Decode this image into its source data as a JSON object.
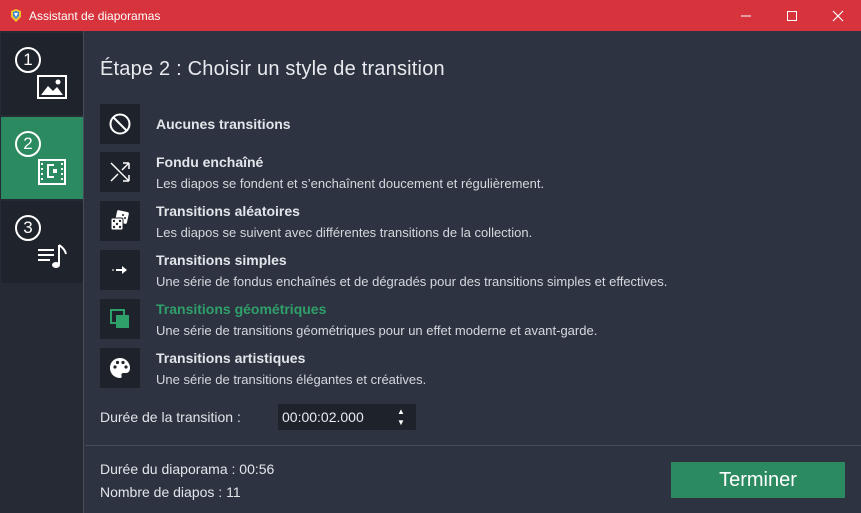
{
  "window": {
    "title": "Assistant de diaporamas",
    "minimize_icon": "minimize-icon",
    "maximize_icon": "maximize-icon",
    "close_icon": "close-icon"
  },
  "sidebar": {
    "steps": [
      {
        "number": "1",
        "icon": "image-icon",
        "active": false
      },
      {
        "number": "2",
        "icon": "film-transition-icon",
        "active": true
      },
      {
        "number": "3",
        "icon": "music-playlist-icon",
        "active": false
      }
    ]
  },
  "main": {
    "heading": "Étape 2 : Choisir un style de transition",
    "options": [
      {
        "title": "Aucunes transitions",
        "desc": "",
        "icon": "no-symbol-icon",
        "selected": false
      },
      {
        "title": "Fondu enchaîné",
        "desc": "Les diapos se fondent et s’enchaînent doucement et régulièrement.",
        "icon": "crossfade-icon",
        "selected": false
      },
      {
        "title": "Transitions aléatoires",
        "desc": "Les diapos se suivent avec différentes transitions de la collection.",
        "icon": "dice-icon",
        "selected": false
      },
      {
        "title": "Transitions simples",
        "desc": "Une série de fondus enchaînés et de dégradés pour des transitions simples et effectives.",
        "icon": "arrow-right-icon",
        "selected": false
      },
      {
        "title": "Transitions géométriques",
        "desc": "Une série de transitions géométriques pour un effet moderne et avant-garde.",
        "icon": "squares-icon",
        "selected": true
      },
      {
        "title": "Transitions artistiques",
        "desc": "Une série de transitions élégantes et créatives.",
        "icon": "palette-icon",
        "selected": false
      }
    ],
    "duration_label": "Durée de la transition :",
    "duration_value": "00:00:02.000"
  },
  "footer": {
    "slideshow_duration": "Durée du diaporama : 00:56",
    "slide_count": "Nombre de diapos : 11",
    "finish_label": "Terminer"
  },
  "colors": {
    "titlebar": "#d6333c",
    "accent": "#2b8a5f",
    "background": "#2d3340"
  }
}
